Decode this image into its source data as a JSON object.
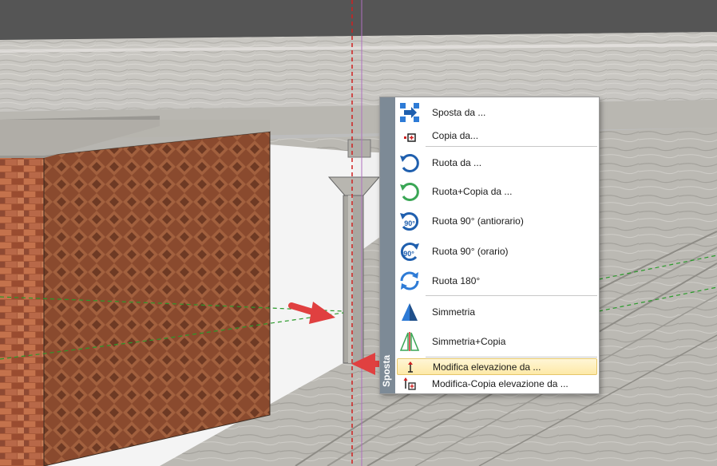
{
  "menu": {
    "sidebar_title": "Sposta",
    "items": [
      {
        "label": "Sposta da ...",
        "icon": "move-arrow-icon"
      },
      {
        "label": "Copia da...",
        "icon": "copy-from-icon"
      },
      {
        "label": "Ruota da ...",
        "icon": "rotate-icon"
      },
      {
        "label": "Ruota+Copia da ...",
        "icon": "rotate-copy-icon"
      },
      {
        "label": "Ruota 90° (antiorario)",
        "icon": "rotate-90-ccw-icon",
        "badge": "90°"
      },
      {
        "label": "Ruota 90° (orario)",
        "icon": "rotate-90-cw-icon",
        "badge": "90°"
      },
      {
        "label": "Ruota 180°",
        "icon": "rotate-180-icon"
      },
      {
        "label": "Simmetria",
        "icon": "mirror-icon"
      },
      {
        "label": "Simmetria+Copia",
        "icon": "mirror-copy-icon"
      },
      {
        "label": "Modifica elevazione da ...",
        "icon": "elevation-icon",
        "highlighted": true
      },
      {
        "label": "Modifica-Copia elevazione da ...",
        "icon": "elevation-copy-icon"
      }
    ]
  },
  "colors": {
    "accent_blue": "#2e7bd6",
    "accent_green": "#3aa655",
    "highlight": "#fde9a7",
    "annotation_arrow": "#e04040"
  }
}
